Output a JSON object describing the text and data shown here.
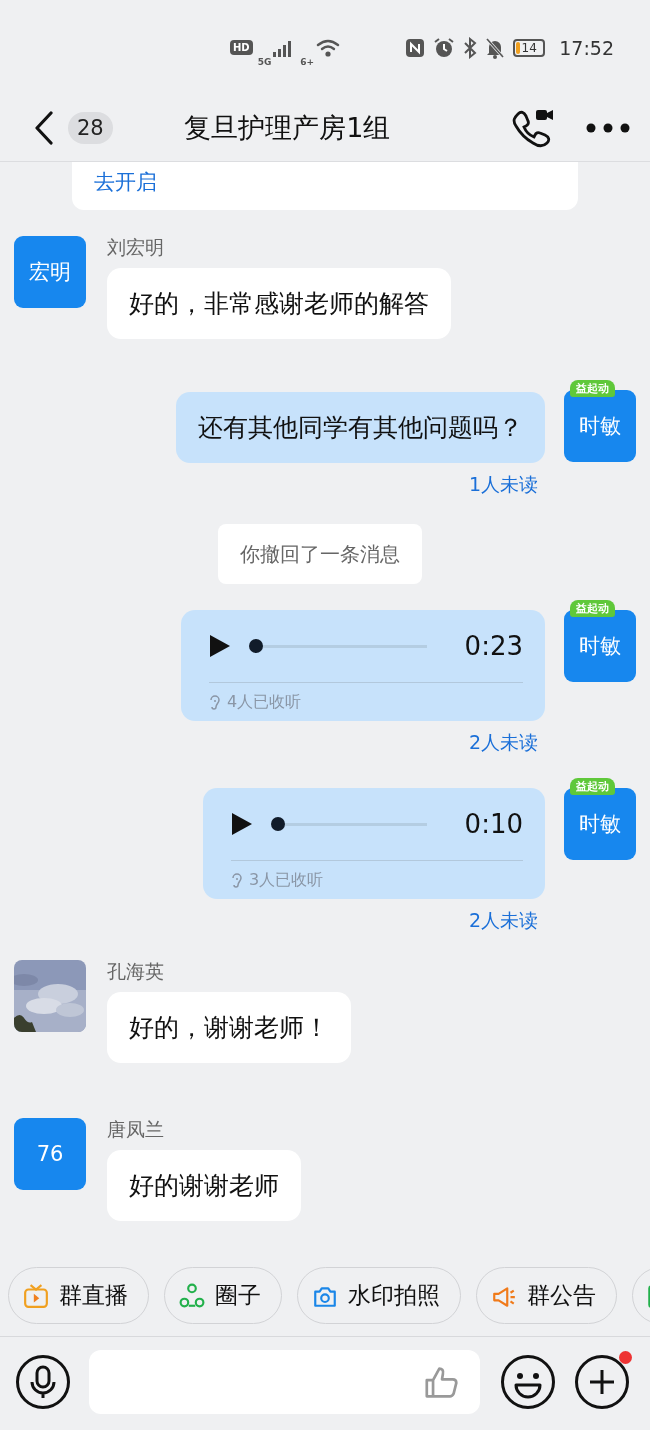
{
  "status_bar": {
    "hd": "HD",
    "network": "5G",
    "wifi": "6+",
    "battery": "14",
    "time": "17:52"
  },
  "header": {
    "unread_count": "28",
    "title": "复旦护理产房1组"
  },
  "messages": [
    {
      "kind": "notice",
      "link": "去开启"
    },
    {
      "kind": "text",
      "outgoing": false,
      "sender": "刘宏明",
      "avatar": {
        "kind": "initials",
        "text": "宏明"
      },
      "text": "好的，非常感谢老师的解答"
    },
    {
      "kind": "text",
      "outgoing": true,
      "avatar": {
        "kind": "initials",
        "text": "时敏",
        "badge": "益起动"
      },
      "text": "还有其他同学有其他问题吗？",
      "receipt": "1人未读"
    },
    {
      "kind": "recall",
      "text": "你撤回了一条消息"
    },
    {
      "kind": "voice",
      "outgoing": true,
      "avatar": {
        "kind": "initials",
        "text": "时敏",
        "badge": "益起动"
      },
      "duration": "0:23",
      "level": 0,
      "listened": "4人已收听",
      "receipt": "2人未读"
    },
    {
      "kind": "voice",
      "outgoing": true,
      "avatar": {
        "kind": "initials",
        "text": "时敏",
        "badge": "益起动"
      },
      "duration": "0:10",
      "level": 0,
      "listened": "3人已收听",
      "receipt": "2人未读"
    },
    {
      "kind": "text",
      "outgoing": false,
      "sender": "孔海英",
      "text": "好的，谢谢老师！"
    },
    {
      "kind": "text",
      "outgoing": false,
      "sender": "唐凤兰",
      "avatar": {
        "kind": "initials",
        "text": "76"
      },
      "text": "好的谢谢老师"
    }
  ],
  "quick_actions": [
    {
      "kind": "live",
      "label": "群直播"
    },
    {
      "kind": "circle",
      "label": "圈子"
    },
    {
      "kind": "camera",
      "label": "水印拍照"
    },
    {
      "kind": "announce",
      "label": "群公告"
    },
    {
      "kind": "doc"
    }
  ],
  "input_bar": {
    "plus_badge": true
  }
}
